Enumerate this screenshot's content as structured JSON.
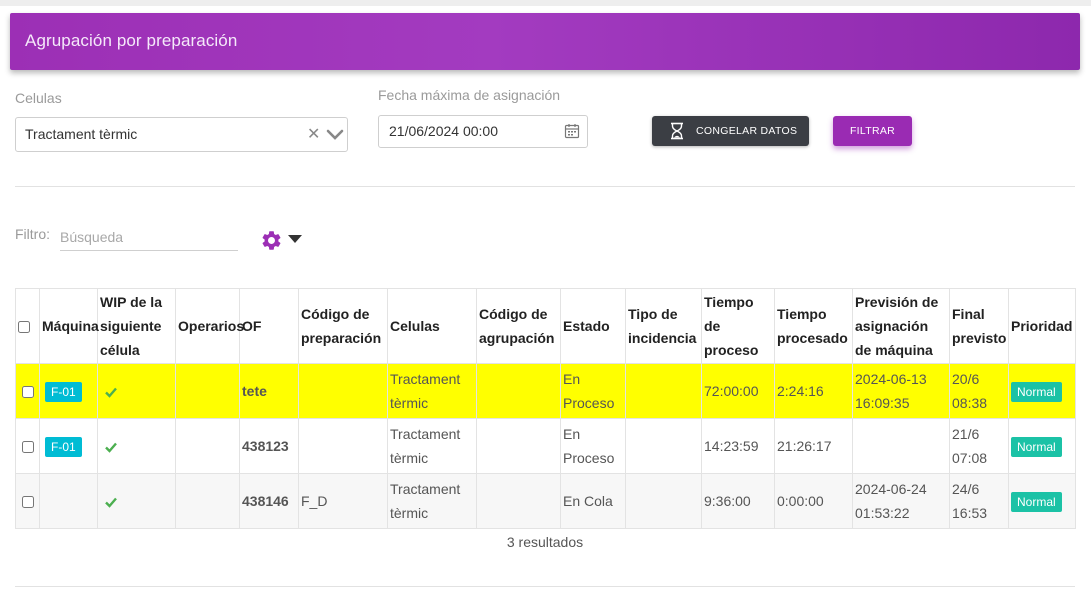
{
  "header": {
    "title": "Agrupación por preparación"
  },
  "filters": {
    "celulas_label": "Celulas",
    "celulas_value": "Tractament tèrmic",
    "celulas_clear": "✕",
    "fecha_label": "Fecha máxima de asignación",
    "fecha_value": "21/06/2024 00:00",
    "freeze_label": "CONGELAR DATOS",
    "filter_label": "FILTRAR"
  },
  "search": {
    "label": "Filtro:",
    "placeholder": "Búsqueda"
  },
  "colors": {
    "accent": "#9c2fb5",
    "highlight": "#ffff00",
    "machine_badge": "#00bcd4",
    "priority_badge": "#1bc2a6",
    "of_green": "#4caf50",
    "estado_purple": "#9c27b0"
  },
  "icons": [
    "hourglass-icon",
    "calendar-icon",
    "gear-icon",
    "chevron-down-icon",
    "check-icon",
    "close-icon"
  ],
  "table": {
    "headers": [
      "Máquina",
      "WIP de la siguiente célula",
      "Operarios",
      "OF",
      "Código de preparación",
      "Celulas",
      "Código de agrupación",
      "Estado",
      "Tipo de incidencia",
      "Tiempo de proceso",
      "Tiempo procesado",
      "Previsión de asignación de máquina",
      "Final previsto",
      "Prioridad"
    ],
    "rows": [
      {
        "maquina": "F-01",
        "operarios": "",
        "of": "tete",
        "codigo_prep": "",
        "celulas": "Tractament tèrmic",
        "codigo_agr": "",
        "estado": "En Proceso",
        "tipo_incidencia": "",
        "tiempo_proceso": "72:00:00",
        "tiempo_procesado": "2:24:16",
        "prevision": "2024-06-13 16:09:35",
        "final": "20/6 08:38",
        "prioridad": "Normal"
      },
      {
        "maquina": "F-01",
        "operarios": "",
        "of": "438123",
        "codigo_prep": "",
        "celulas": "Tractament tèrmic",
        "codigo_agr": "",
        "estado": "En Proceso",
        "tipo_incidencia": "",
        "tiempo_proceso": "14:23:59",
        "tiempo_procesado": "21:26:17",
        "prevision": "",
        "final": "21/6 07:08",
        "prioridad": "Normal"
      },
      {
        "maquina": "",
        "operarios": "",
        "of": "438146",
        "codigo_prep": "F_D",
        "celulas": "Tractament tèrmic",
        "codigo_agr": "",
        "estado": "En Cola",
        "tipo_incidencia": "",
        "tiempo_proceso": "9:36:00",
        "tiempo_procesado": "0:00:00",
        "prevision": "2024-06-24 01:53:22",
        "final": "24/6 16:53",
        "prioridad": "Normal"
      }
    ],
    "results": "3 resultados"
  }
}
